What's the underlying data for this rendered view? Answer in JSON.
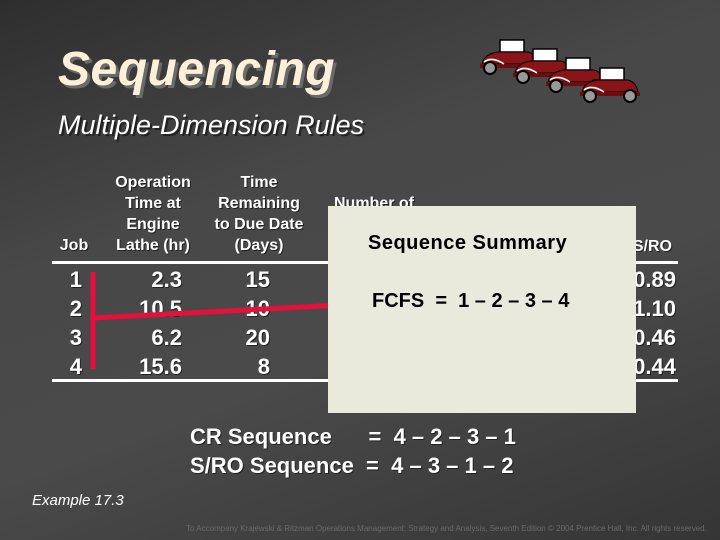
{
  "slide": {
    "title": "Sequencing",
    "subtitle": "Multiple-Dimension Rules",
    "decoration": "vintage-cars-icon"
  },
  "table": {
    "headers": {
      "job": "Job",
      "op_time": [
        "Operation",
        "Time at",
        "Engine",
        "Lathe (hr)"
      ],
      "time_remaining": [
        "Time",
        "Remaining",
        "to Due Date",
        "(Days)"
      ],
      "number_of": "Number of",
      "sro": "S/RO"
    },
    "rows": [
      {
        "job": "1",
        "op_time": "2.3",
        "days": "15",
        "sro": "0.89"
      },
      {
        "job": "2",
        "op_time": "10.5",
        "days": "10",
        "sro": "1.10"
      },
      {
        "job": "3",
        "op_time": "6.2",
        "days": "20",
        "sro": "0.46"
      },
      {
        "job": "4",
        "op_time": "15.6",
        "days": "8",
        "sro": "0.44"
      }
    ]
  },
  "popup": {
    "title": "Sequence Summary",
    "fcfs": "FCFS  =  1 – 2 – 3 – 4"
  },
  "sequences": {
    "cr": "CR Sequence      =  4 – 2 – 3 – 1",
    "sro": "S/RO Sequence  =  4 – 3 – 1 – 2"
  },
  "example": "Example 17.3",
  "footer": "To Accompany Krajewski & Ritzman Operations Management: Strategy and Analysis, Seventh Edition © 2004 Prentice Hall, Inc. All rights reserved.",
  "colors": {
    "arrow": "#e8103a",
    "popup_bg": "#e9eadc",
    "title": "#fdf0d8"
  }
}
